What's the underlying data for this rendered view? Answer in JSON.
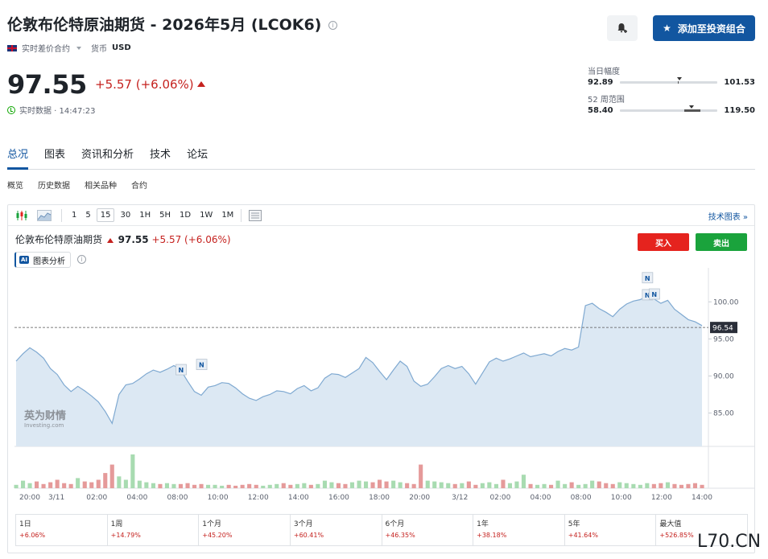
{
  "header": {
    "title": "伦敦布伦特原油期货 - 2026年5月 (LCOK6)",
    "contract_type": "实时差价合约",
    "currency_label": "货币",
    "currency": "USD",
    "price": "97.55",
    "change": "+5.57 (+6.06%)",
    "status": "实时数据 · 14:47:23",
    "add_portfolio": "添加至投资组合"
  },
  "ranges": {
    "day_label": "当日幅度",
    "day_low": "92.89",
    "day_high": "101.53",
    "week52_label": "52 周范围",
    "week52_low": "58.40",
    "week52_high": "119.50"
  },
  "tabs": [
    "总况",
    "图表",
    "资讯和分析",
    "技术",
    "论坛"
  ],
  "subtabs": [
    "概览",
    "历史数据",
    "相关品种",
    "合约"
  ],
  "toolbar": {
    "timeframes": [
      "1",
      "5",
      "15",
      "30",
      "1H",
      "5H",
      "1D",
      "1W",
      "1M"
    ],
    "selected": "15",
    "tech_chart": "技术图表 »"
  },
  "chart_header": {
    "name": "伦敦布伦特原油期货",
    "price": "97.55",
    "change": "+5.57 (+6.06%)",
    "buy": "买入",
    "sell": "卖出",
    "ai_label": "图表分析",
    "ai_badge": "AI",
    "news_marker": "N",
    "watermark_cn": "英为财情",
    "watermark_en": "Investing.com"
  },
  "colors": {
    "accent": "#1256a0",
    "down": "#c5221f",
    "buy": "#e5231e",
    "sell": "#1aa33c",
    "line": "#7fa9d1",
    "area": "#dce8f3"
  },
  "chart_data": {
    "type": "area",
    "y_ticks": [
      "100.00",
      "95.00",
      "90.00",
      "85.00"
    ],
    "ylim": [
      80.5,
      103.5
    ],
    "last_price_label": "96.54",
    "last_price": 96.54,
    "x_labels": [
      "20:00",
      "3/11",
      "02:00",
      "04:00",
      "08:00",
      "10:00",
      "12:00",
      "14:00",
      "16:00",
      "18:00",
      "20:00",
      "3/12",
      "02:00",
      "04:00",
      "08:00",
      "10:00",
      "12:00",
      "14:00"
    ],
    "values": [
      92.0,
      93.0,
      93.8,
      93.2,
      92.4,
      91.0,
      90.2,
      88.8,
      87.9,
      88.6,
      88.0,
      87.3,
      86.5,
      85.2,
      83.6,
      87.5,
      88.8,
      89.0,
      89.6,
      90.3,
      90.8,
      90.5,
      90.9,
      91.4,
      90.8,
      89.3,
      87.9,
      87.4,
      88.5,
      88.7,
      89.1,
      89.0,
      88.4,
      87.6,
      87.0,
      86.7,
      87.2,
      87.5,
      88.0,
      87.9,
      87.6,
      88.3,
      88.7,
      88.0,
      88.4,
      89.7,
      90.3,
      90.2,
      89.8,
      90.4,
      91.0,
      92.5,
      91.8,
      90.6,
      89.5,
      90.8,
      92.0,
      91.3,
      89.3,
      88.6,
      88.9,
      89.9,
      91.0,
      91.4,
      91.0,
      91.3,
      90.3,
      88.9,
      90.4,
      91.9,
      92.4,
      92.0,
      92.3,
      92.7,
      93.1,
      92.6,
      92.8,
      93.0,
      92.7,
      93.3,
      93.7,
      93.5,
      93.9,
      99.5,
      99.8,
      99.1,
      98.6,
      98.0,
      99.0,
      99.7,
      100.1,
      100.3,
      100.8,
      100.4,
      99.8,
      100.2,
      99.0,
      98.3,
      97.6,
      97.3,
      96.8
    ],
    "volume": [
      4,
      9,
      6,
      8,
      5,
      7,
      10,
      6,
      5,
      12,
      8,
      7,
      10,
      18,
      28,
      14,
      10,
      40,
      9,
      7,
      6,
      5,
      6,
      5,
      5,
      6,
      4,
      5,
      4,
      4,
      3,
      4,
      3,
      4,
      5,
      4,
      3,
      4,
      5,
      6,
      4,
      5,
      6,
      4,
      5,
      9,
      7,
      6,
      5,
      7,
      9,
      8,
      7,
      10,
      8,
      9,
      7,
      6,
      5,
      28,
      9,
      8,
      7,
      6,
      5,
      6,
      8,
      4,
      6,
      7,
      5,
      10,
      6,
      8,
      16,
      5,
      4,
      5,
      4,
      9,
      5,
      7,
      4,
      5,
      9,
      8,
      6,
      5,
      7,
      6,
      5,
      4,
      6,
      5,
      6,
      7,
      5,
      4,
      5,
      6,
      4
    ],
    "news_markers": [
      {
        "index": 24,
        "value": 90.8
      },
      {
        "index": 27,
        "value": 91.5
      },
      {
        "index": 92,
        "value": 103.2
      },
      {
        "index": 92,
        "value": 100.9
      },
      {
        "index": 93,
        "value": 101.0
      }
    ]
  },
  "performance": [
    {
      "label": "1日",
      "value": "+6.06%"
    },
    {
      "label": "1周",
      "value": "+14.79%"
    },
    {
      "label": "1个月",
      "value": "+45.20%"
    },
    {
      "label": "3个月",
      "value": "+60.41%"
    },
    {
      "label": "6个月",
      "value": "+46.35%"
    },
    {
      "label": "1年",
      "value": "+38.18%"
    },
    {
      "label": "5年",
      "value": "+41.64%"
    },
    {
      "label": "最大值",
      "value": "+526.85%"
    }
  ],
  "site_watermark": "L70.CN"
}
